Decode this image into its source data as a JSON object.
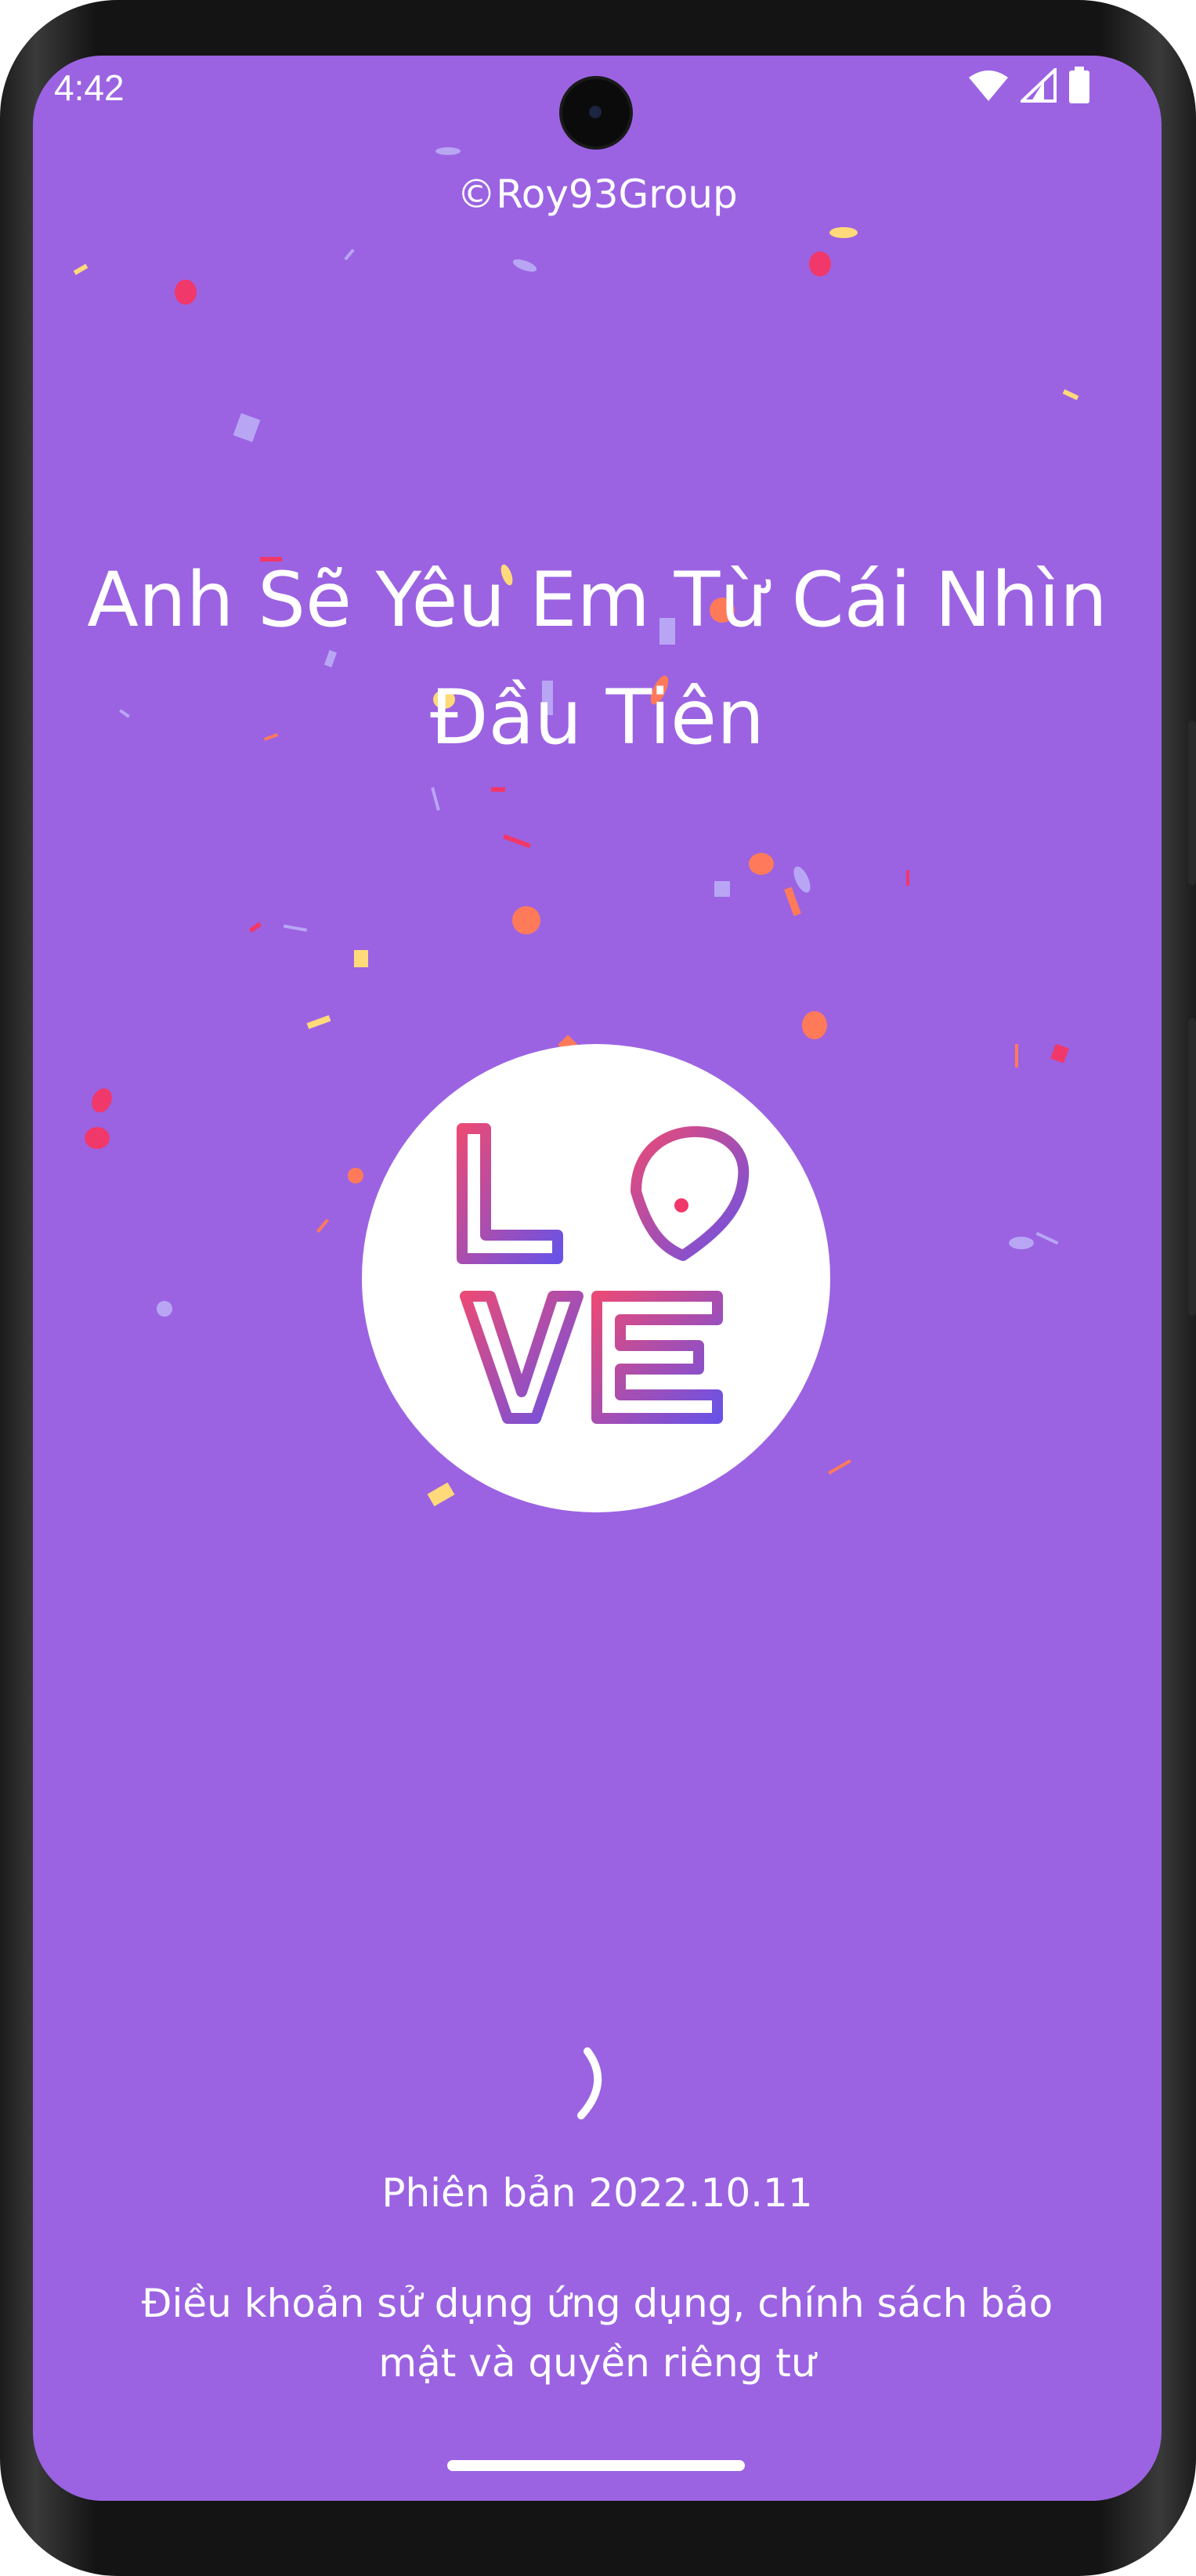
{
  "status_bar": {
    "time": "4:42",
    "icons": [
      "wifi-icon",
      "cellular-signal-icon",
      "battery-icon"
    ]
  },
  "header": {
    "copyright": "©Roy93Group"
  },
  "main": {
    "title": "Anh Sẽ Yêu Em Từ Cái Nhìn Đầu Tiên",
    "logo": {
      "letters": [
        "L",
        "O",
        "V",
        "E"
      ],
      "gradient_start": "#e94a77",
      "gradient_end": "#7a4fe0"
    }
  },
  "footer": {
    "version": "Phiên bản 2022.10.11",
    "terms": "Điều khoản sử dụng ứng dụng, chính sách bảo mật và quyền riêng tư"
  },
  "colors": {
    "background": "#9b63e2",
    "text": "#ffffff",
    "confetti": [
      "#f0386b",
      "#ffd97a",
      "#ff7a59",
      "#b8a6f5"
    ]
  }
}
